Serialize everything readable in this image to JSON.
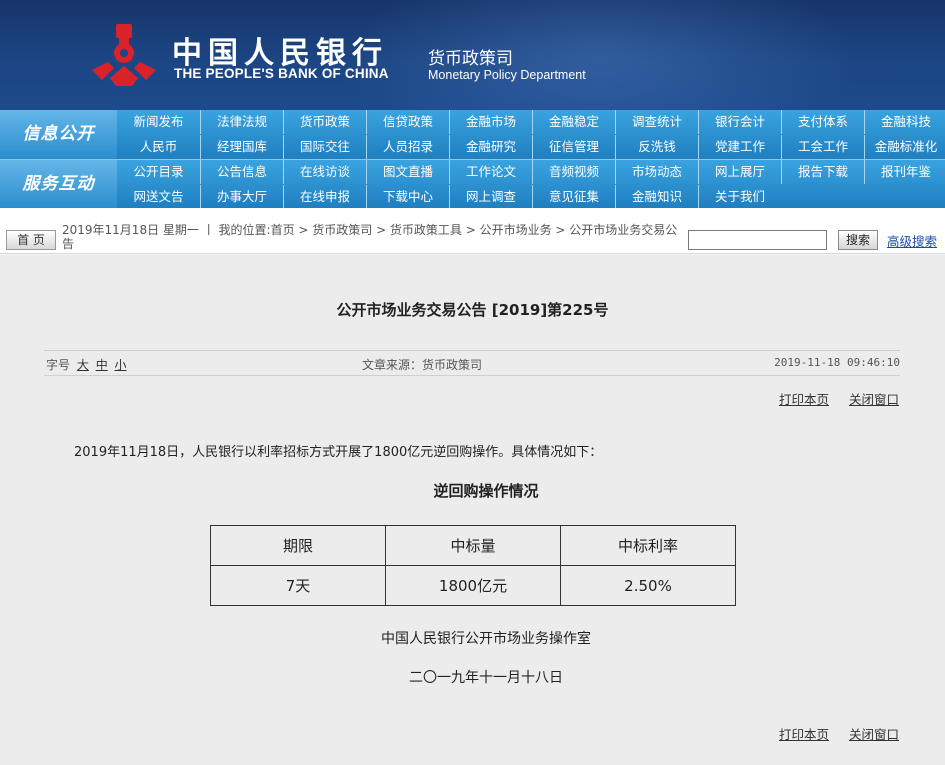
{
  "header": {
    "cn_name": "中国人民银行",
    "en_name": "THE PEOPLE'S BANK OF CHINA",
    "dept_cn": "货币政策司",
    "dept_en": "Monetary Policy Department",
    "brand_color": "#1d4a8b",
    "logo_color": "#d9222a"
  },
  "nav": {
    "info_title": "信息公开",
    "service_title": "服务互动",
    "info_row1": [
      "新闻发布",
      "法律法规",
      "货币政策",
      "信贷政策",
      "金融市场",
      "金融稳定",
      "调查统计",
      "银行会计",
      "支付体系",
      "金融科技"
    ],
    "info_row2": [
      "人民币",
      "经理国库",
      "国际交往",
      "人员招录",
      "金融研究",
      "征信管理",
      "反洗钱",
      "党建工作",
      "工会工作",
      "金融标准化"
    ],
    "service_row1": [
      "公开目录",
      "公告信息",
      "在线访谈",
      "图文直播",
      "工作论文",
      "音频视频",
      "市场动态",
      "网上展厅",
      "报告下载",
      "报刊年鉴"
    ],
    "service_row2": [
      "网送文告",
      "办事大厅",
      "在线申报",
      "下载中心",
      "网上调查",
      "意见征集",
      "金融知识",
      "关于我们"
    ]
  },
  "crumbbar": {
    "home_label": "首 页",
    "text": "2019年11月18日 星期一 丨 我的位置:首页 > 货币政策司 > 货币政策工具 > 公开市场业务 > 公开市场业务交易公告",
    "search_label": "搜索",
    "advanced_label": "高级搜索"
  },
  "article": {
    "title": "公开市场业务交易公告 [2019]第225号",
    "font_size_label": "字号",
    "size_large": "大",
    "size_medium": "中",
    "size_small": "小",
    "source": "文章来源：货币政策司",
    "time": "2019-11-18 09:46:10",
    "print_label": "打印本页",
    "close_label": "关闭窗口",
    "paragraph": "2019年11月18日，人民银行以利率招标方式开展了1800亿元逆回购操作。具体情况如下：",
    "table_title": "逆回购操作情况",
    "table_headers": [
      "期限",
      "中标量",
      "中标利率"
    ],
    "table_row": [
      "7天",
      "1800亿元",
      "2.50%"
    ],
    "signature": "中国人民银行公开市场业务操作室",
    "date": "二〇一九年十一月十八日"
  }
}
